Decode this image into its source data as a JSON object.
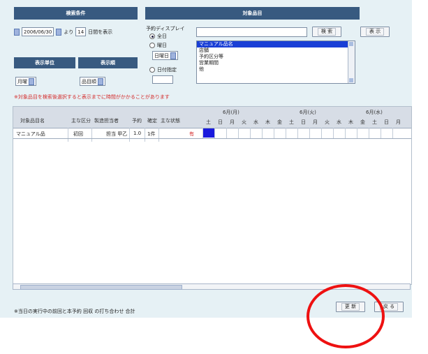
{
  "header": {
    "search_title": "検索条件",
    "spec_title": "対象品目",
    "period_title": "表示単位",
    "sort_title": "表示順"
  },
  "date_control": {
    "date_value": "2006/06/30",
    "from_label": "より",
    "days_value": "14",
    "days_suffix": "日間を表示"
  },
  "target_label": "予約ディスプレイ",
  "radios": [
    {
      "label": "全日",
      "checked": true
    },
    {
      "label": "曜日",
      "checked": false
    },
    {
      "label": "日付指定",
      "checked": false
    }
  ],
  "weekday_select": "日曜日",
  "search_input": {
    "value": "",
    "placeholder": ""
  },
  "buttons": {
    "search": "検 索",
    "show": "表 示",
    "update": "更 新",
    "back": "戻 る"
  },
  "listbox_items": [
    {
      "label": "マニュアル品名",
      "selected": true
    },
    {
      "label": "店舗",
      "selected": false
    },
    {
      "label": "予約区分等",
      "selected": false
    },
    {
      "label": "営業期間",
      "selected": false
    },
    {
      "label": "他",
      "selected": false
    }
  ],
  "period_select": "月曜",
  "sort_select": "品目順",
  "warning": "※対象品目を検索後選択すると表示までに時間がかかることがあります",
  "table": {
    "columns": [
      "対象品目名",
      "主な区分",
      "製造担当者",
      "予約",
      "確定",
      "主な状態"
    ],
    "week_headers": [
      "6月(月)",
      "6月(火)",
      "6月(水)"
    ],
    "day_cells": [
      "土",
      "日",
      "月",
      "火",
      "水",
      "木",
      "金",
      "土",
      "日",
      "月",
      "火",
      "水",
      "木",
      "金",
      "土",
      "日",
      "月"
    ],
    "rows": [
      {
        "name": "マニュアル品",
        "kind": "初回",
        "owner": "担当 甲乙",
        "reserve": "1.0",
        "confirm": "1件",
        "status": "有",
        "bar_color": "#1a1add"
      }
    ]
  },
  "footer_text": "※当日の実行中の前回と本予約 回収 の打ち合わせ 合計"
}
